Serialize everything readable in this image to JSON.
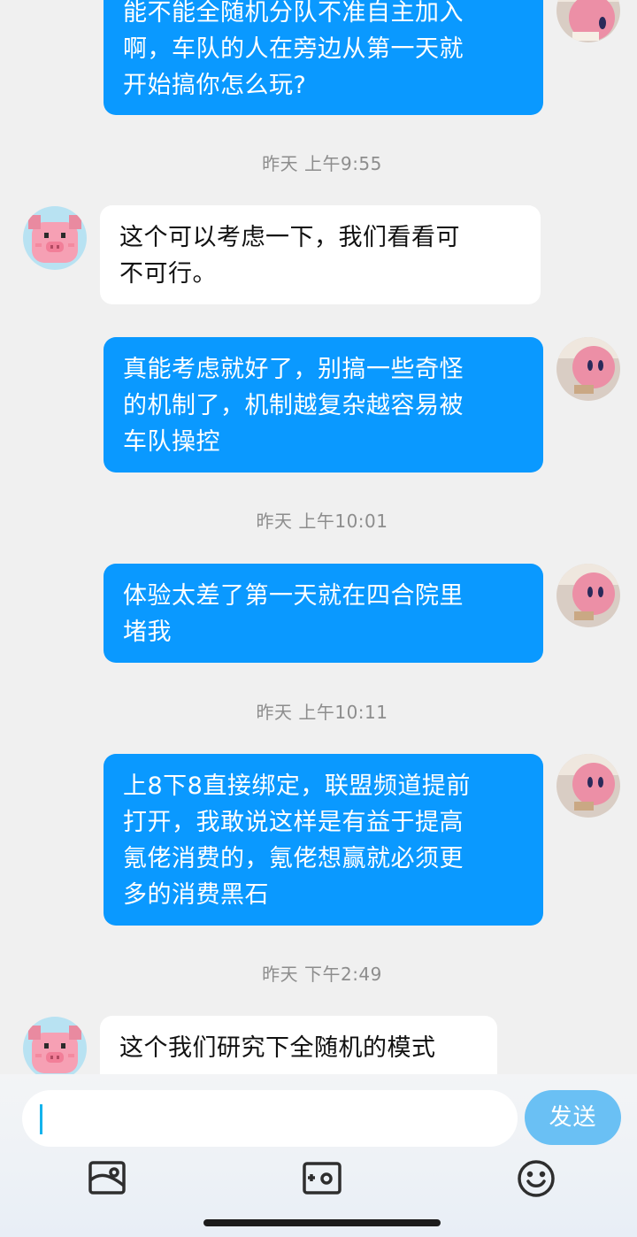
{
  "messages": [
    {
      "id": "m1",
      "side": "me",
      "lines": [
        "能不能全随机分队不准自主加入",
        "啊，车队的人在旁边从第一天就",
        "开始搞你怎么玩?"
      ]
    },
    {
      "id": "t1",
      "type": "timestamp",
      "text": "昨天 上午9:55"
    },
    {
      "id": "m2",
      "side": "them",
      "lines": [
        "这个可以考虑一下，我们看看可",
        "不可行。"
      ]
    },
    {
      "id": "m3",
      "side": "me",
      "lines": [
        "真能考虑就好了，别搞一些奇怪",
        "的机制了，机制越复杂越容易被",
        "车队操控"
      ]
    },
    {
      "id": "t2",
      "type": "timestamp",
      "text": "昨天 上午10:01"
    },
    {
      "id": "m4",
      "side": "me",
      "lines": [
        "体验太差了第一天就在四合院里",
        "堵我"
      ]
    },
    {
      "id": "t3",
      "type": "timestamp",
      "text": "昨天 上午10:11"
    },
    {
      "id": "m5",
      "side": "me",
      "lines": [
        "上8下8直接绑定，联盟频道提前",
        "打开，我敢说这样是有益于提高",
        "氪佬消费的，氪佬想赢就必须更",
        "多的消费黑石"
      ]
    },
    {
      "id": "t4",
      "type": "timestamp",
      "text": "昨天 下午2:49"
    },
    {
      "id": "m6",
      "side": "them",
      "lines": [
        "这个我们研究下全随机的模式"
      ]
    }
  ],
  "input": {
    "value": "",
    "send_label": "发送"
  },
  "toolbar": {
    "icons": [
      "image-icon",
      "camera-icon",
      "emoji-icon"
    ]
  },
  "colors": {
    "my_bubble": "#0a99ff",
    "their_bubble": "#ffffff",
    "send_button": "#6ac0f4",
    "background": "#f0f0f0"
  }
}
